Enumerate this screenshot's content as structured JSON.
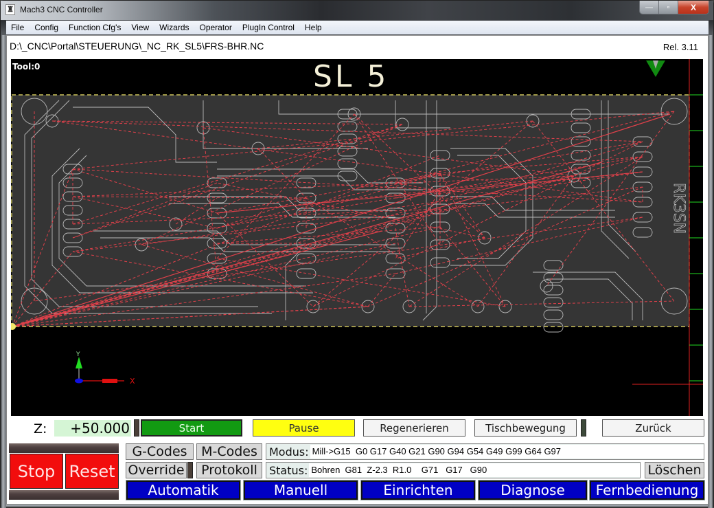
{
  "window": {
    "title": "Mach3 CNC Controller",
    "app_icon": "mach3-app-icon",
    "controls": {
      "minimize": "—",
      "maximize": "▫",
      "close": "X"
    }
  },
  "menu": [
    "File",
    "Config",
    "Function Cfg's",
    "View",
    "Wizards",
    "Operator",
    "PlugIn Control",
    "Help"
  ],
  "header": {
    "file_path": "D:\\_CNC\\Portal\\STEUERUNG\\_NC_RK_SL5\\FRS-BHR.NC",
    "release": "Rel. 3.11"
  },
  "toolpath": {
    "tool_label": "Tool:0",
    "profile_title": "SL 5",
    "board_text": "RK3SN",
    "colors": {
      "background": "#000000",
      "board": "#353535",
      "outline": "#b9b9b9",
      "path": "#e0404a",
      "boundary": "#f2e86a",
      "axis_x": "#e01010",
      "axis_y": "#22dd22",
      "axis_z": "#1010e0"
    },
    "axis_labels": {
      "x": "X",
      "y": "Y"
    }
  },
  "z_axis": {
    "label": "Z:",
    "value": "+50.000"
  },
  "buttons": {
    "start": "Start",
    "pause": "Pause",
    "regenerate": "Regenerieren",
    "table_move": "Tischbewegung",
    "back": "Zurück",
    "stop": "Stop",
    "reset": "Reset",
    "gcodes": "G-Codes",
    "mcodes": "M-Codes",
    "override": "Override",
    "protocol": "Protokoll",
    "clear": "Löschen"
  },
  "modus": {
    "label": "Modus:",
    "value": "Mill->G15  G0 G17 G40 G21 G90 G94 G54 G49 G99 G64 G97"
  },
  "status": {
    "label": "Status:",
    "value": "Bohren  G81  Z-2.3  R1.0    G71   G17   G90"
  },
  "nav_tabs": [
    "Automatik",
    "Manuell",
    "Einrichten",
    "Diagnose",
    "Fernbedienung"
  ],
  "colors": {
    "start_green": "#129a12",
    "pause_yellow": "#ffff10",
    "stop_red": "#f20d0d",
    "tab_blue": "#0000c4",
    "z_value_bg": "#d5f5d5"
  }
}
